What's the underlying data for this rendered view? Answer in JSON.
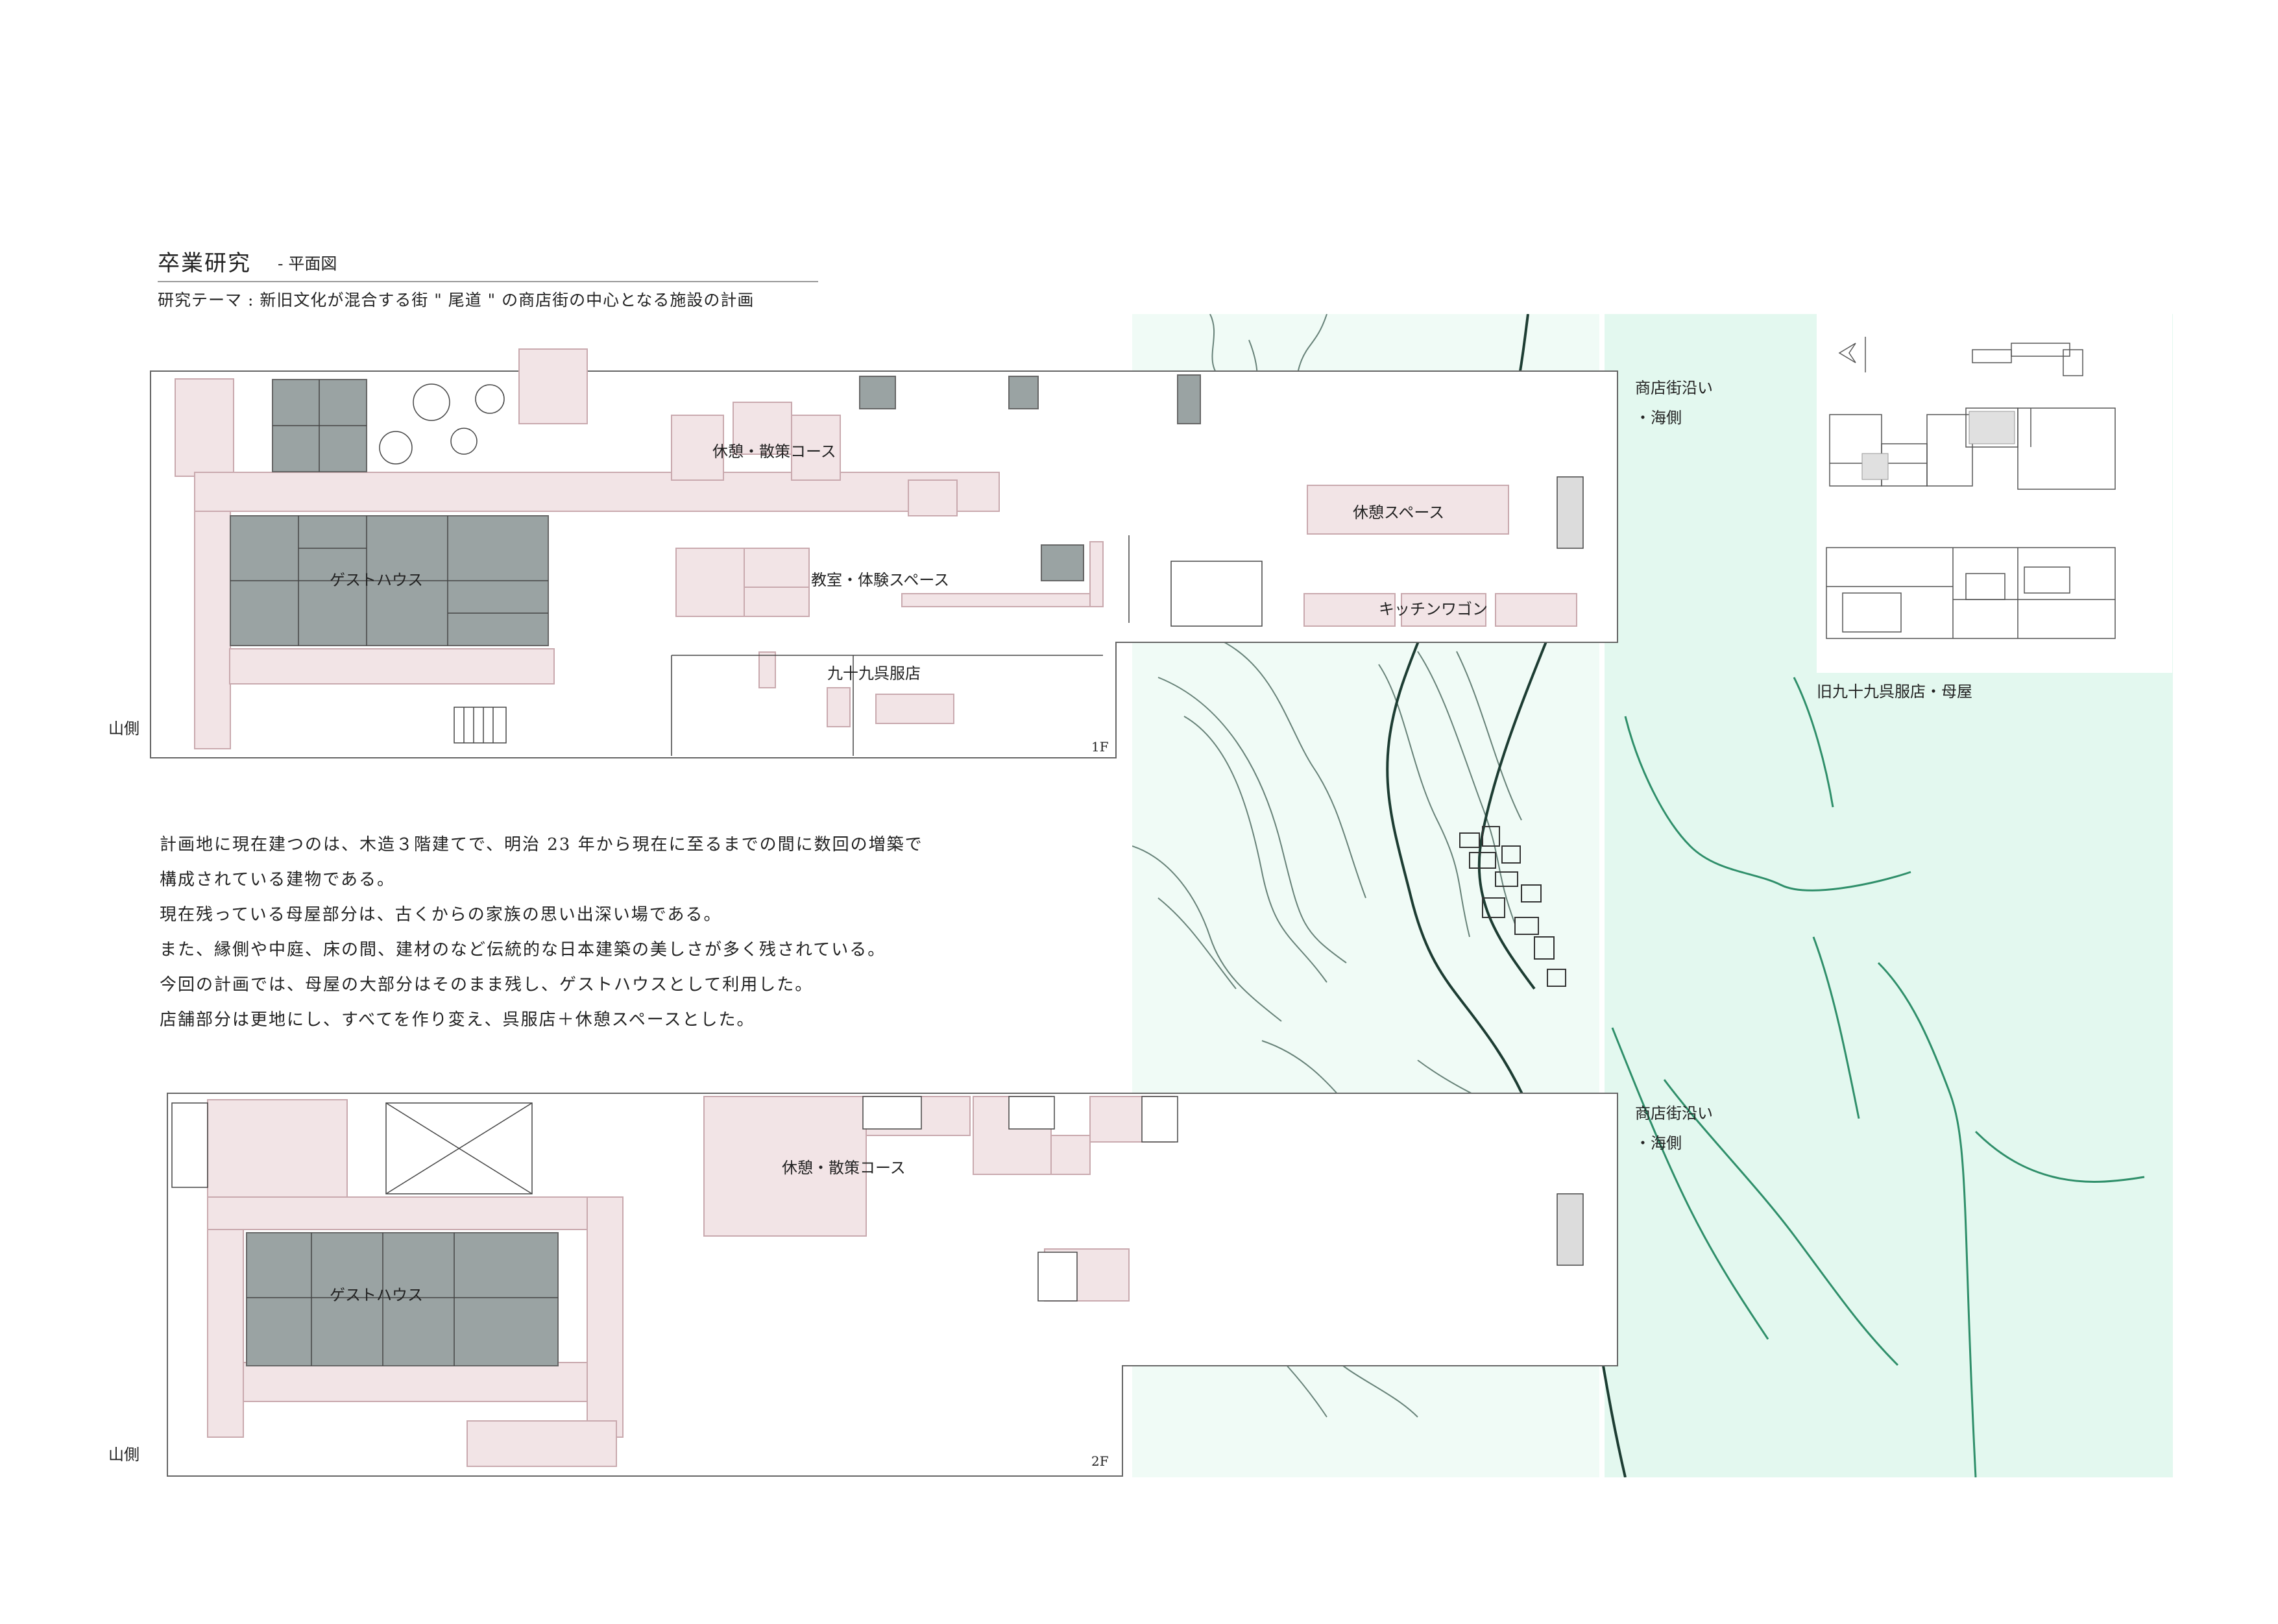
{
  "header": {
    "title": "卒業研究",
    "subtitle": "- 平面図",
    "theme": "研究テーマ : 新旧文化が混合する街 \" 尾道 \" の商店街の中心となる施設の計画"
  },
  "description": [
    "計画地に現在建つのは、木造３階建てで、明治 23 年から現在に至るまでの間に数回の増築で",
    "構成されている建物である。",
    "現在残っている母屋部分は、古くからの家族の思い出深い場である。",
    "また、縁側や中庭、床の間、建材のなど伝統的な日本建築の美しさが多く残されている。",
    "今回の計画では、母屋の大部分はそのまま残し、ゲストハウスとして利用した。",
    "店舗部分は更地にし、すべてを作り変え、呉服店＋休憩スペースとした。"
  ],
  "plan_1f": {
    "floor": "1F",
    "side_label": "山側",
    "rooms": {
      "rest_course": "休憩・散策コース",
      "guesthouse": "ゲストハウス",
      "classroom": "教室・体験スペース",
      "kimono_shop": "九十九呉服店",
      "rest_space": "休憩スペース",
      "kitchen_wagon": "キッチンワゴン"
    },
    "street_label_line1": "商店街沿い",
    "street_label_line2": "・海側"
  },
  "plan_2f": {
    "floor": "2F",
    "side_label": "山側",
    "rooms": {
      "rest_course": "休憩・散策コース",
      "guesthouse": "ゲストハウス"
    },
    "street_label_line1": "商店街沿い",
    "street_label_line2": "・海側"
  },
  "old_building": {
    "caption": "旧九十九呉服店・母屋"
  },
  "colors": {
    "pink": "#f2e4e6",
    "pink_stroke": "#c9a9ae",
    "tatami": "#9aa3a3",
    "green_band": "#e3f8ef",
    "line": "#555555"
  }
}
